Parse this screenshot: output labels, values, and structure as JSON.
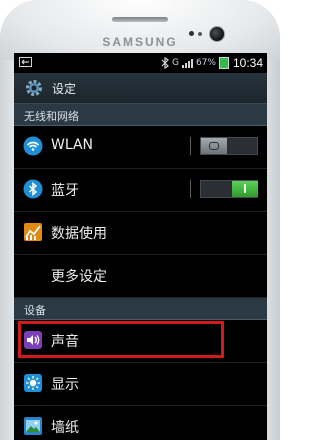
{
  "device": {
    "brand": "SAMSUNG"
  },
  "status_bar": {
    "time": "10:34",
    "battery_percent": "67%",
    "network": "G"
  },
  "title_bar": {
    "title": "设定",
    "icon": "settings-gear-icon"
  },
  "sections": [
    {
      "header": "无线和网络",
      "items": [
        {
          "label": "WLAN",
          "icon": "wifi-icon",
          "toggle": "off"
        },
        {
          "label": "蓝牙",
          "icon": "bluetooth-icon",
          "toggle": "on"
        },
        {
          "label": "数据使用",
          "icon": "data-usage-icon"
        },
        {
          "label": "更多设定"
        }
      ]
    },
    {
      "header": "设备",
      "items": [
        {
          "label": "声音",
          "icon": "sound-icon",
          "highlighted": true
        },
        {
          "label": "显示",
          "icon": "display-icon"
        },
        {
          "label": "墙纸",
          "icon": "wallpaper-icon"
        }
      ]
    }
  ],
  "colors": {
    "highlight": "#d11a1a",
    "toggle_on": "#3db83a",
    "section_bg": "#2a3944"
  }
}
